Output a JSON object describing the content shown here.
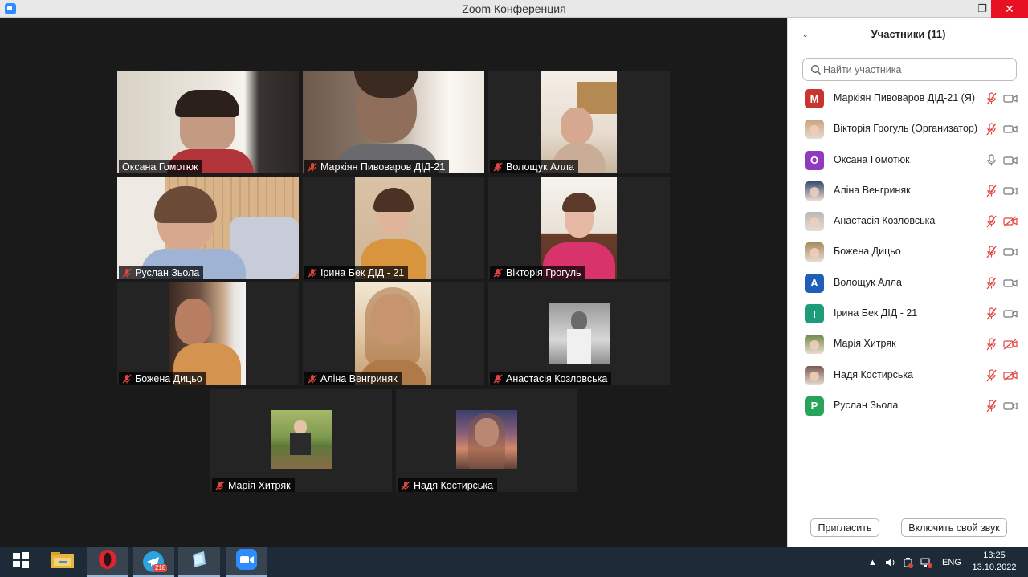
{
  "window": {
    "title": "Zoom Конференция"
  },
  "tiles": [
    {
      "name": "Оксана Гомотюк",
      "muted": false,
      "active": true
    },
    {
      "name": "Маркіян Пивоваров ДІД-21",
      "muted": true
    },
    {
      "name": "Волощук Алла",
      "muted": true
    },
    {
      "name": "Руслан Зьола",
      "muted": true
    },
    {
      "name": "Ірина Бек ДІД - 21",
      "muted": true
    },
    {
      "name": "Вікторія Грогуль",
      "muted": true
    },
    {
      "name": "Божена Дицьо",
      "muted": true
    },
    {
      "name": "Аліна Венгриняк",
      "muted": true
    },
    {
      "name": "Анастасія Козловська",
      "muted": true
    },
    {
      "name": "Марія Хитряк",
      "muted": true
    },
    {
      "name": "Надя Костирська",
      "muted": true
    }
  ],
  "panel": {
    "title": "Участники (11)",
    "search_placeholder": "Найти участника",
    "participants": [
      {
        "name": "Маркіян Пивоваров ДІД-21 (Я)",
        "avatar": "М",
        "avatar_color": "#c8352e",
        "mic": "muted",
        "cam": "on"
      },
      {
        "name": "Вікторія Грогуль (Организатор)",
        "avatar": "photo",
        "avatar_color": "#c9a27e",
        "mic": "muted",
        "cam": "on"
      },
      {
        "name": "Оксана Гомотюк",
        "avatar": "О",
        "avatar_color": "#8e3bbf",
        "mic": "on",
        "cam": "on"
      },
      {
        "name": "Аліна Венгриняк",
        "avatar": "photo",
        "avatar_color": "#3a4a6e",
        "mic": "muted",
        "cam": "on"
      },
      {
        "name": "Анастасія Козловська",
        "avatar": "photo",
        "avatar_color": "#b8b8b8",
        "mic": "muted",
        "cam": "off"
      },
      {
        "name": "Божена Дицьо",
        "avatar": "photo",
        "avatar_color": "#a8895e",
        "mic": "muted",
        "cam": "on"
      },
      {
        "name": "Волощук Алла",
        "avatar": "А",
        "avatar_color": "#1f5fb8",
        "mic": "muted",
        "cam": "on"
      },
      {
        "name": "Ірина Бек ДІД - 21",
        "avatar": "І",
        "avatar_color": "#1e9b78",
        "mic": "muted",
        "cam": "on"
      },
      {
        "name": "Марія Хитряк",
        "avatar": "photo",
        "avatar_color": "#6f8a4a",
        "mic": "muted",
        "cam": "off"
      },
      {
        "name": "Надя Костирська",
        "avatar": "photo",
        "avatar_color": "#7a5a52",
        "mic": "muted",
        "cam": "off"
      },
      {
        "name": "Руслан Зьола",
        "avatar": "Р",
        "avatar_color": "#27a35a",
        "mic": "muted",
        "cam": "on"
      }
    ],
    "invite_label": "Пригласить",
    "unmute_label": "Включить свой звук"
  },
  "taskbar": {
    "telegram_badge": "218",
    "language": "ENG",
    "time": "13:25",
    "date": "13.10.2022"
  },
  "icons": [
    "zoom-app-icon",
    "minimize-icon",
    "maximize-icon",
    "close-icon",
    "chevron-down-icon",
    "search-icon",
    "mic-muted-icon",
    "mic-icon",
    "camera-icon",
    "camera-off-icon",
    "windows-start-icon",
    "file-explorer-icon",
    "opera-icon",
    "telegram-icon",
    "notepad-icon",
    "zoom-taskbar-icon"
  ]
}
